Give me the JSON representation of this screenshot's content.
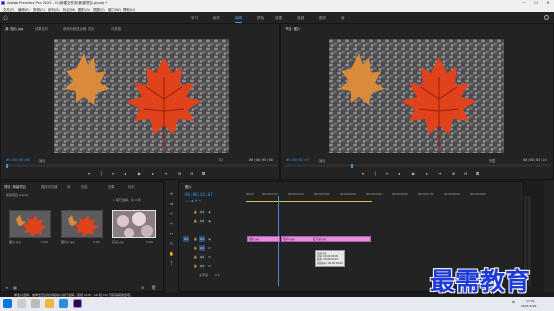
{
  "window": {
    "title": "Adobe Premiere Pro 2020 - D:\\新建文件夹\\新建项目.prproj *",
    "controls": [
      "—",
      "☐",
      "✕"
    ]
  },
  "menu": [
    "文件(F)",
    "编辑(E)",
    "剪辑(C)",
    "序列(S)",
    "标记(M)",
    "图形(G)",
    "视图(V)",
    "窗口(W)",
    "帮助(H)"
  ],
  "workspaces": [
    "学习",
    "组件",
    "编辑",
    "颜色",
    "效果",
    "音频",
    "图形",
    "库"
  ],
  "workspace_active_index": 2,
  "source_monitor": {
    "tabs": [
      "源: 图片.jpg",
      "效果控件",
      "音频剪辑混合器: 图片",
      "元数据"
    ],
    "timecode_left": "00;00;00;00",
    "fit": "适合",
    "fraction": "1/2",
    "timecode_right": "00;00;05;00"
  },
  "program_monitor": {
    "tabs": [
      "节目: 图片"
    ],
    "timecode_left": "00;00;01;07",
    "fit": "适合",
    "fraction": "完整",
    "timecode_right": "00;00;03;24"
  },
  "transport_icons": [
    "mark-in-icon",
    "mark-out-icon",
    "go-to-in-icon",
    "step-back-icon",
    "play-icon",
    "step-forward-icon",
    "go-to-out-icon",
    "insert-icon",
    "overwrite-icon",
    "export-frame-icon"
  ],
  "project": {
    "tabs": [
      "项目: 新建项目",
      "媒体浏览器",
      "库",
      "信息",
      "效果",
      "标记"
    ],
    "path": "新建项目.prproj",
    "selection_info": "1 项已选择，共 4 项",
    "items": [
      {
        "name": "图片.jpg",
        "duration": "5:00"
      },
      {
        "name": "图片2.jpg",
        "duration": "5:00"
      },
      {
        "name": "花朵.jpg",
        "duration": "5:00"
      }
    ]
  },
  "timeline": {
    "tab": "图片",
    "timecode": "00;00;01;07",
    "ruler_labels": [
      "00;00",
      "00;00;01;00",
      "00;00;02;00",
      "00;00;03;00",
      "00;00;04;00",
      "00;00;05;00",
      "00;00;06;00",
      "00;00;07;00",
      "00;00;08;00",
      "00;00;09;00"
    ],
    "video_tracks": [
      "V3",
      "V2",
      "V1"
    ],
    "audio_tracks": [
      "A1",
      "A2",
      "A3"
    ],
    "master_label": "主声道",
    "master_value": "0.0",
    "clips": [
      {
        "name": "图片.jpg"
      },
      {
        "name": "图片2.jpg"
      },
      {
        "name": "花朵.jpg"
      }
    ],
    "tooltip": [
      "花朵.jpg",
      "开始: 00;00;03;00",
      "结束: 00;00;04;29",
      "持续时间: 00;00;02;00"
    ]
  },
  "status_bar": "单击以选择，或单击空白处并拖动以进行选择。使用 Shift、Alt 和 Ctrl 可获得其他选项。",
  "taskbar": {
    "time": "17:21",
    "date": "2021/5/26",
    "lang": "中"
  },
  "watermark": "最需教育",
  "colors": {
    "accent": "#3b8ee0",
    "clip": "#e290de",
    "watermark": "#1e3bd8"
  }
}
